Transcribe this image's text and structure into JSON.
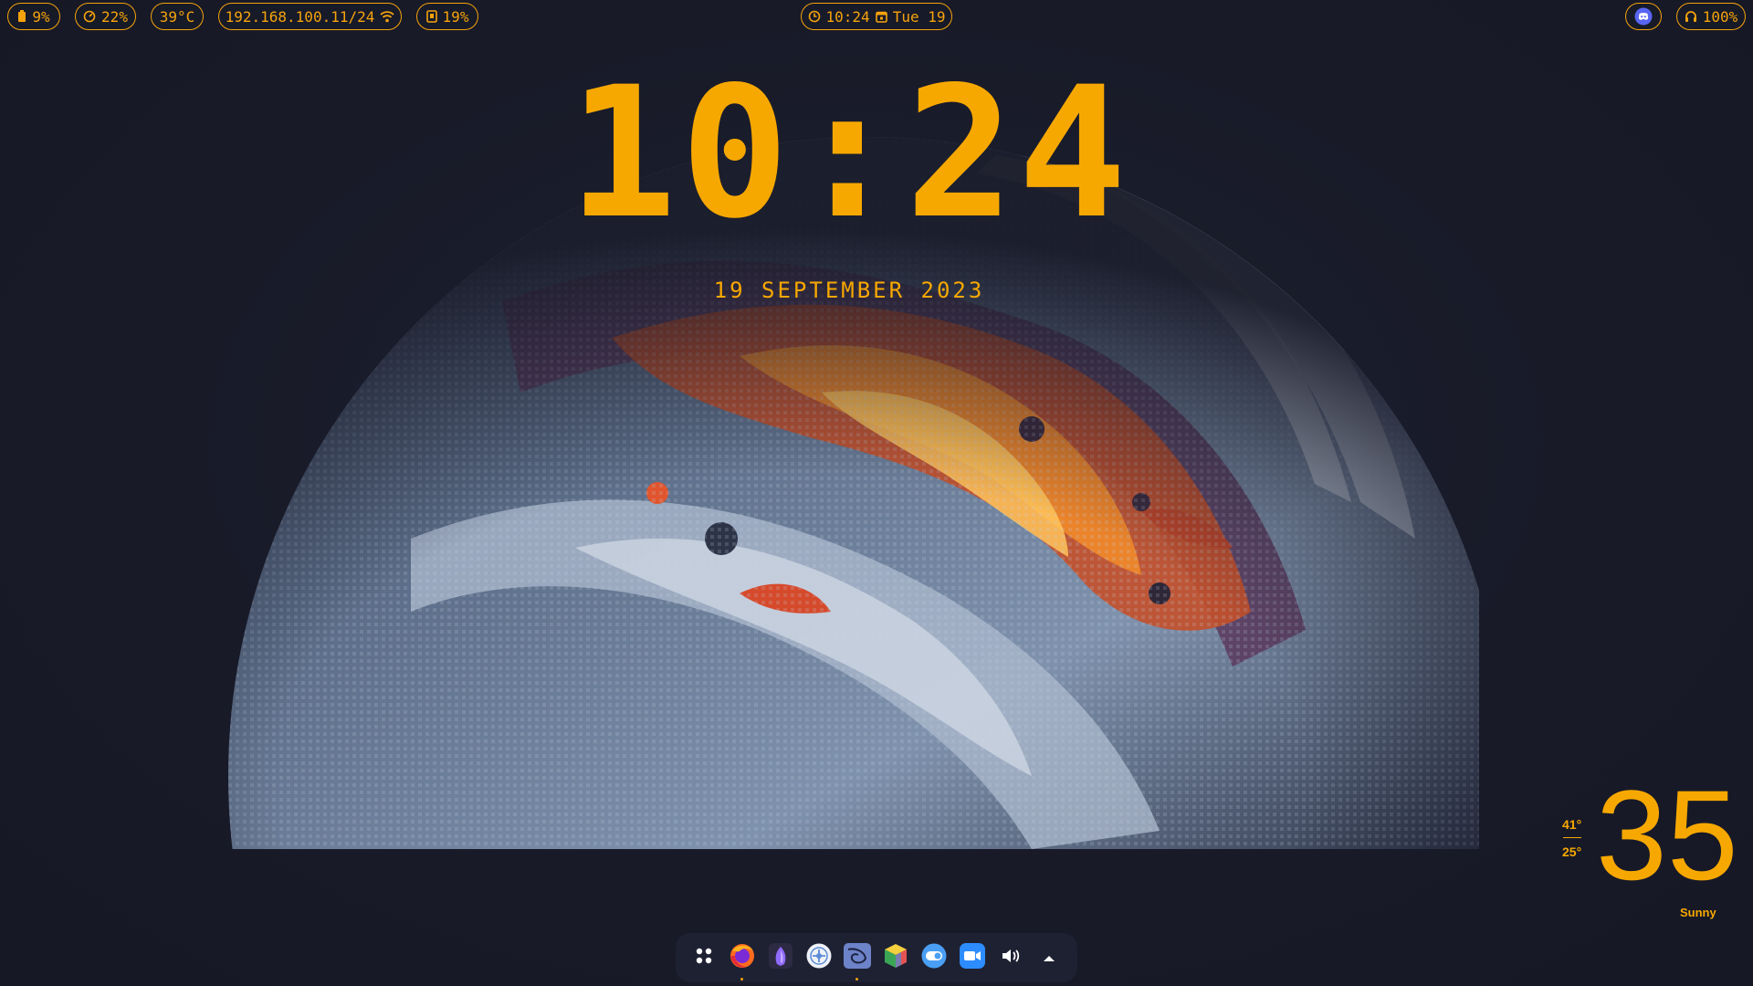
{
  "topbar": {
    "battery": "9%",
    "cpu": "22%",
    "temperature": "39°C",
    "network": "192.168.100.11/24",
    "memory": "19%",
    "time": "10:24",
    "date": "Tue 19",
    "volume": "100%"
  },
  "clock": {
    "time": "10:24",
    "date": "19 SEPTEMBER 2023"
  },
  "weather": {
    "temperature": "35",
    "high": "41°",
    "low": "25°",
    "condition": "Sunny"
  },
  "dock": {
    "items": [
      "app-grid",
      "firefox",
      "proton-vpn",
      "element",
      "kdenlive",
      "maps",
      "toggle",
      "zoom",
      "volume",
      "tray-expand"
    ]
  },
  "colors": {
    "accent": "#f5a30c",
    "background": "#181a28",
    "dock": "#1e2132"
  }
}
